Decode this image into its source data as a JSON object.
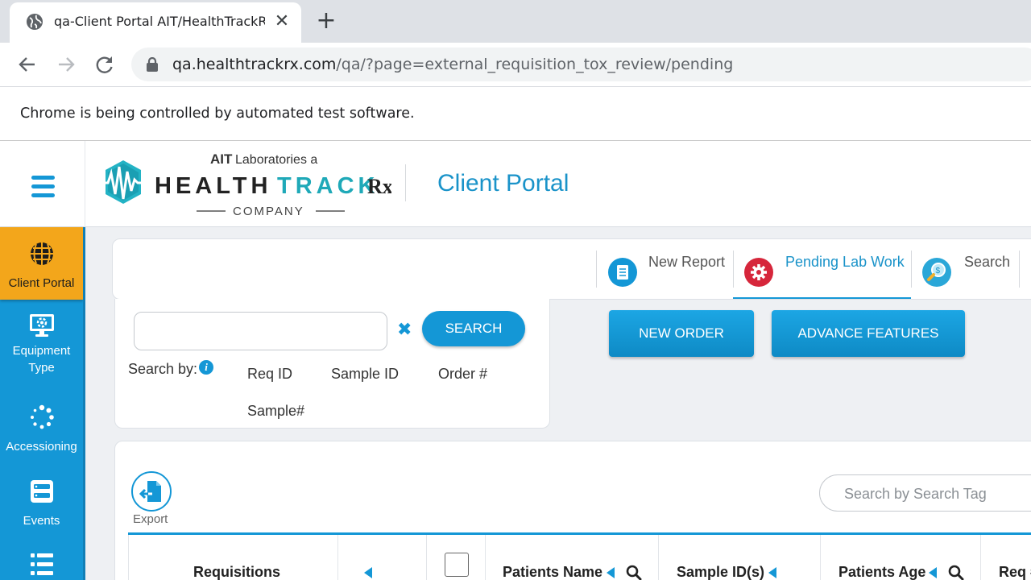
{
  "browser": {
    "tab_title": "qa-Client Portal AIT/HealthTrackRx",
    "url_domain": "qa.healthtrackrx.com",
    "url_path": "/qa/?page=external_requisition_tox_review/pending",
    "infobar_text": "Chrome is being controlled by automated test software."
  },
  "header": {
    "portal_title": "Client Portal",
    "logo": {
      "top_line_bold": "AIT",
      "top_line_rest": "Laboratories a",
      "brand_a": "HEALTH",
      "brand_b": "TRACK",
      "brand_c": "Rx",
      "bottom_line": "COMPANY"
    }
  },
  "sidebar": {
    "items": [
      {
        "label": "Client Portal",
        "icon": "globe-grid-icon",
        "active": true
      },
      {
        "label": "Equipment Type",
        "icon": "monitor-gear-icon",
        "active": false
      },
      {
        "label": "Accessioning",
        "icon": "spinner-icon",
        "active": false
      },
      {
        "label": "Events",
        "icon": "server-list-icon",
        "active": false
      },
      {
        "label": "",
        "icon": "list-icon",
        "active": false
      }
    ]
  },
  "top_tabs": [
    {
      "label": "New Report",
      "icon": "document-icon",
      "color": "#1497d6",
      "active": false
    },
    {
      "label": "Pending Lab Work",
      "icon": "gear-icon",
      "color": "#d6263b",
      "active": true
    },
    {
      "label": "Search",
      "icon": "magnifier-money-icon",
      "color": "#2aa7d8",
      "active": false
    }
  ],
  "search_panel": {
    "input_value": "",
    "search_button": "SEARCH",
    "search_by_label": "Search by:",
    "options": [
      "Req ID",
      "Sample ID",
      "Order #",
      "Sample#"
    ]
  },
  "actions": {
    "new_order": "NEW ORDER",
    "advance_features": "ADVANCE FEATURES"
  },
  "table": {
    "export_label": "Export",
    "tag_search_placeholder": "Search by Search Tag",
    "columns": [
      "Requisitions",
      "",
      "",
      "Patients Name",
      "Sample ID(s)",
      "Patients Age",
      "Req #"
    ]
  },
  "colors": {
    "accent": "#1497d6",
    "active_sidebar": "#f3a61b",
    "pending_tab_icon": "#d6263b"
  }
}
